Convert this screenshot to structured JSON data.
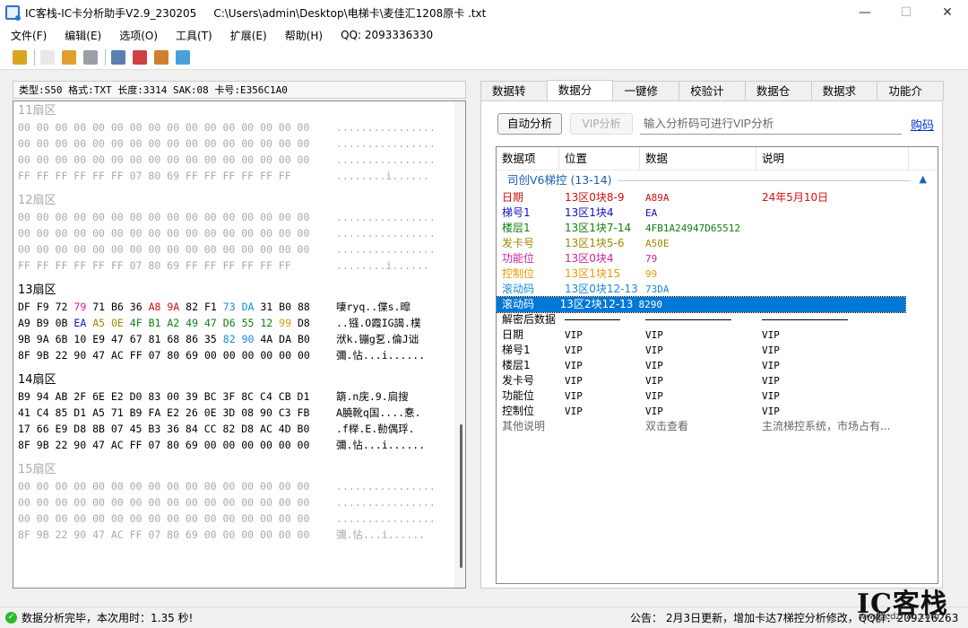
{
  "window": {
    "title": "IC客栈-IC卡分析助手V2.9_230205     C:\\Users\\admin\\Desktop\\电梯卡\\麦佳汇1208原卡 .txt",
    "minimize": "—",
    "maximize": "☐",
    "close": "✕"
  },
  "menu": [
    "文件(F)",
    "编辑(E)",
    "选项(O)",
    "工具(T)",
    "扩展(E)",
    "帮助(H)",
    "QQ:  2093336330"
  ],
  "toolbar": {
    "icons": [
      "open-folder-icon",
      "new-file-icon",
      "edit-icon",
      "save-icon",
      "search-icon",
      "calendar-icon",
      "chart-icon",
      "refresh-icon"
    ],
    "colors": [
      "#d9a520",
      "#e8e8e8",
      "#e0a030",
      "#9aa0a8",
      "#5a7fb0",
      "#d04040",
      "#d08030",
      "#4aa0d8"
    ]
  },
  "card_info": "类型:S50 格式:TXT 长度:3314 SAK:08 卡号:E356C1A0",
  "sectors": [
    {
      "title": "11扇区",
      "gray": true,
      "rows": [
        {
          "hex": "00 00 00 00 00 00 00 00 00 00 00 00 00 00 00 00",
          "ascii": "................"
        },
        {
          "hex": "00 00 00 00 00 00 00 00 00 00 00 00 00 00 00 00",
          "ascii": "................"
        },
        {
          "hex": "00 00 00 00 00 00 00 00 00 00 00 00 00 00 00 00",
          "ascii": "................"
        },
        {
          "hex": "FF FF FF FF FF FF 07 80 69 FF FF FF FF FF FF",
          "ascii": "........i......"
        }
      ]
    },
    {
      "title": "12扇区",
      "gray": true,
      "rows": [
        {
          "hex": "00 00 00 00 00 00 00 00 00 00 00 00 00 00 00 00",
          "ascii": "................"
        },
        {
          "hex": "00 00 00 00 00 00 00 00 00 00 00 00 00 00 00 00",
          "ascii": "................"
        },
        {
          "hex": "00 00 00 00 00 00 00 00 00 00 00 00 00 00 00 00",
          "ascii": "................"
        },
        {
          "hex": "FF FF FF FF FF FF 07 80 69 FF FF FF FF FF FF",
          "ascii": "........i......"
        }
      ]
    },
    {
      "title": "13扇区",
      "gray": false,
      "rows": [
        {
          "bytes": [
            [
              "DF",
              ""
            ],
            [
              "F9",
              ""
            ],
            [
              "72",
              ""
            ],
            [
              "79",
              "#d0219c"
            ],
            [
              "71",
              ""
            ],
            [
              "B6",
              ""
            ],
            [
              "36",
              ""
            ],
            [
              "A8",
              "#d01010"
            ],
            [
              "9A",
              "#d01010"
            ],
            [
              "82",
              ""
            ],
            [
              "F1",
              ""
            ],
            [
              "73",
              "#1a8ad6"
            ],
            [
              "DA",
              "#1a8ad6"
            ],
            [
              "31",
              ""
            ],
            [
              "B0",
              ""
            ],
            [
              "88",
              ""
            ]
          ],
          "ascii": "啛ryq..偞s.暭"
        },
        {
          "bytes": [
            [
              "A9",
              ""
            ],
            [
              "B9",
              ""
            ],
            [
              "0B",
              ""
            ],
            [
              "EA",
              "#1010c0"
            ],
            [
              "A5",
              "#a08800"
            ],
            [
              "0E",
              "#a08800"
            ],
            [
              "4F",
              "#108010"
            ],
            [
              "B1",
              "#108010"
            ],
            [
              "A2",
              "#108010"
            ],
            [
              "49",
              "#108010"
            ],
            [
              "47",
              "#108010"
            ],
            [
              "D6",
              "#108010"
            ],
            [
              "55",
              "#108010"
            ],
            [
              "12",
              "#108010"
            ],
            [
              "99",
              "#e89b00"
            ],
            [
              "D8",
              ""
            ]
          ],
          "ascii": "..镪.O霞IG謁.樸"
        },
        {
          "bytes": [
            [
              "9B",
              ""
            ],
            [
              "9A",
              ""
            ],
            [
              "6B",
              ""
            ],
            [
              "10",
              ""
            ],
            [
              "E9",
              ""
            ],
            [
              "47",
              ""
            ],
            [
              "67",
              ""
            ],
            [
              "81",
              ""
            ],
            [
              "68",
              ""
            ],
            [
              "86",
              ""
            ],
            [
              "35",
              ""
            ],
            [
              "82",
              "#1a8ad6"
            ],
            [
              "90",
              "#1a8ad6"
            ],
            [
              "4A",
              ""
            ],
            [
              "DA",
              ""
            ],
            [
              "B0",
              ""
            ]
          ],
          "ascii": "洑k.镚g乭.倫J诎"
        },
        {
          "bytes": [
            [
              "8F",
              ""
            ],
            [
              "9B",
              ""
            ],
            [
              "22",
              ""
            ],
            [
              "90",
              ""
            ],
            [
              "47",
              ""
            ],
            [
              "AC",
              ""
            ],
            [
              "FF",
              ""
            ],
            [
              "07",
              ""
            ],
            [
              "80",
              ""
            ],
            [
              "69",
              ""
            ],
            [
              "00",
              ""
            ],
            [
              "00",
              ""
            ],
            [
              "00",
              ""
            ],
            [
              "00",
              ""
            ],
            [
              "00",
              ""
            ],
            [
              "00",
              ""
            ]
          ],
          "ascii": "彌.怗...i......"
        }
      ]
    },
    {
      "title": "14扇区",
      "gray": false,
      "rows": [
        {
          "hex": "B9 94 AB 2F 6E E2 D0 83 00 39 BC 3F 8C C4 CB D1",
          "ascii": "箶.n庑.9.扃搜"
        },
        {
          "hex": "41 C4 85 D1 A5 71 B9 FA E2 26 0E 3D 08 90 C3 FB",
          "ascii": "A膮靴q国....惷."
        },
        {
          "hex": "17 66 E9 D8 8B 07 45 B3 36 84 CC 82 D8 AC 4D B0",
          "ascii": ".f榉.E.勌偶琈."
        },
        {
          "hex": "8F 9B 22 90 47 AC FF 07 80 69 00 00 00 00 00 00",
          "ascii": "彌.怗...i......"
        }
      ]
    },
    {
      "title": "15扇区",
      "gray": true,
      "rows": [
        {
          "hex": "00 00 00 00 00 00 00 00 00 00 00 00 00 00 00 00",
          "ascii": "................"
        },
        {
          "hex": "00 00 00 00 00 00 00 00 00 00 00 00 00 00 00 00",
          "ascii": "................"
        },
        {
          "hex": "00 00 00 00 00 00 00 00 00 00 00 00 00 00 00 00",
          "ascii": "................"
        },
        {
          "hex": "8F 9B 22 90 47 AC FF 07 80 69 00 00 00 00 00 00",
          "ascii": "彌.怗...i......"
        }
      ]
    }
  ],
  "tabs": [
    "数据转换",
    "数据分析",
    "一键修改",
    "校验计算",
    "数据仓库",
    "数据求助",
    "功能介绍"
  ],
  "analysis": {
    "auto_btn": "自动分析",
    "vip_btn": "VIP分析",
    "vip_placeholder": "输入分析码可进行VIP分析",
    "buy_link": "购码",
    "headers": [
      "数据项",
      "位置",
      "数据",
      "说明"
    ],
    "group": "司创V6梯控 (13-14)",
    "rows": [
      {
        "item": "日期",
        "pos": "13区0块8-9",
        "data": "A89A",
        "desc": "24年5月10日",
        "color": "#d01010"
      },
      {
        "item": "梯号1",
        "pos": "13区1块4",
        "data": "EA",
        "desc": "",
        "color": "#1010c0"
      },
      {
        "item": "楼层1",
        "pos": "13区1块7-14",
        "data": "4FB1A24947D65512",
        "desc": "",
        "color": "#108010"
      },
      {
        "item": "发卡号",
        "pos": "13区1块5-6",
        "data": "A50E",
        "desc": "",
        "color": "#a08800"
      },
      {
        "item": "功能位",
        "pos": "13区0块4",
        "data": "79",
        "desc": "",
        "color": "#d0219c"
      },
      {
        "item": "控制位",
        "pos": "13区1块15",
        "data": "99",
        "desc": "",
        "color": "#e89b00"
      },
      {
        "item": "滚动码",
        "pos": "13区0块12-13",
        "data": "73DA",
        "desc": "",
        "color": "#1a8ad6"
      },
      {
        "item": "滚动码",
        "pos": "13区2块12-13",
        "data": "8290",
        "desc": "",
        "color": "#ffffff",
        "selected": true
      }
    ],
    "decrypt_label": "解密后数据",
    "vip_rows": [
      {
        "item": "日期",
        "pos": "VIP",
        "data": "VIP",
        "desc": "VIP"
      },
      {
        "item": "梯号1",
        "pos": "VIP",
        "data": "VIP",
        "desc": "VIP"
      },
      {
        "item": "楼层1",
        "pos": "VIP",
        "data": "VIP",
        "desc": "VIP"
      },
      {
        "item": "发卡号",
        "pos": "VIP",
        "data": "VIP",
        "desc": "VIP"
      },
      {
        "item": "功能位",
        "pos": "VIP",
        "data": "VIP",
        "desc": "VIP"
      },
      {
        "item": "控制位",
        "pos": "VIP",
        "data": "VIP",
        "desc": "VIP"
      }
    ],
    "other": {
      "item": "其他说明",
      "data": "双击查看",
      "desc": "主流梯控系统，市场占有..."
    }
  },
  "status": {
    "text": "数据分析完毕，本次用时：1.35 秒!",
    "notice": "公告：  2月3日更新，增加卡达7梯控分析修改，QQ群：209216263"
  },
  "watermark": {
    "big": "IC客栈",
    "small": "www.icdzhan.com"
  }
}
